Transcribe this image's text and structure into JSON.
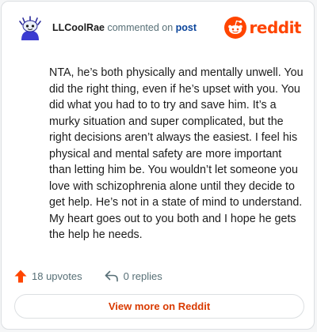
{
  "header": {
    "username": "LLCoolRae",
    "action": "commented on",
    "post_link": "post",
    "brand": "reddit",
    "avatar_icon": "snoo-avatar-icon",
    "brand_icon": "reddit-logo-icon"
  },
  "comment": {
    "text": "NTA, he’s both physically and mentally unwell. You did the right thing, even if he’s upset with you. You did what you had to to try and save him. It’s a murky situation and super complicated, but the right decisions aren’t always the easiest. I feel his physical and mental safety are more important than letting him be. You wouldn’t let someone you love with schizophrenia alone until they decide to get help. He’s not in a state of mind to understand. My heart goes out to you both and I hope he gets the help he needs."
  },
  "stats": {
    "upvotes": "18 upvotes",
    "upvote_icon": "upvote-arrow-icon",
    "replies": "0 replies",
    "reply_icon": "reply-arrow-icon"
  },
  "footer": {
    "view_more_label": "View more on Reddit"
  },
  "colors": {
    "brand": "#ff4500",
    "link": "#0a449b",
    "view_more": "#d93a00",
    "muted": "#576f76"
  }
}
